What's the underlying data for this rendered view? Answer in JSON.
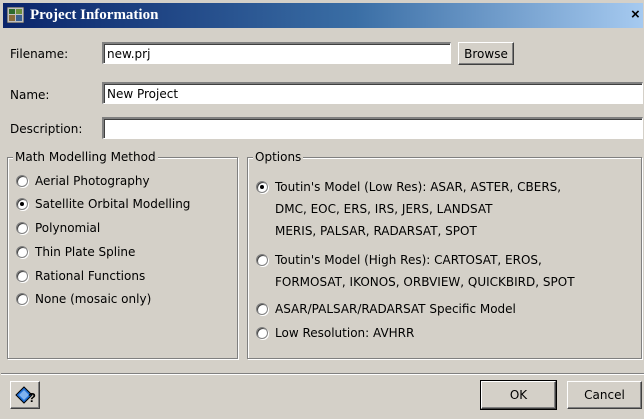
{
  "window": {
    "title": "Project Information",
    "close_glyph": "×"
  },
  "fields": {
    "filename_label": "Filename:",
    "filename_value": "new.prj",
    "browse_label": "Browse",
    "name_label": "Name:",
    "name_value": "New Project",
    "description_label": "Description:",
    "description_value": ""
  },
  "math_modelling": {
    "legend": "Math Modelling Method",
    "options": [
      {
        "label": "Aerial Photography",
        "checked": false
      },
      {
        "label": "Satellite Orbital Modelling",
        "checked": true
      },
      {
        "label": "Polynomial",
        "checked": false
      },
      {
        "label": "Thin Plate Spline",
        "checked": false
      },
      {
        "label": "Rational Functions",
        "checked": false
      },
      {
        "label": "None (mosaic only)",
        "checked": false
      }
    ]
  },
  "options": {
    "legend": "Options",
    "items": [
      {
        "lines": [
          "Toutin's Model (Low Res): ASAR, ASTER, CBERS,",
          "DMC, EOC, ERS, IRS, JERS, LANDSAT",
          "MERIS, PALSAR, RADARSAT, SPOT"
        ],
        "checked": true
      },
      {
        "lines": [
          "Toutin's Model (High Res): CARTOSAT, EROS,",
          "FORMOSAT, IKONOS, ORBVIEW, QUICKBIRD, SPOT"
        ],
        "checked": false
      },
      {
        "lines": [
          "ASAR/PALSAR/RADARSAT Specific Model"
        ],
        "checked": false
      },
      {
        "lines": [
          "Low Resolution: AVHRR"
        ],
        "checked": false
      }
    ]
  },
  "footer": {
    "help_icon": "context-help-icon",
    "ok_label": "OK",
    "cancel_label": "Cancel"
  },
  "colors": {
    "face": "#d4d0c8",
    "titlebar_start": "#0a246a",
    "titlebar_end": "#a6caf0"
  }
}
